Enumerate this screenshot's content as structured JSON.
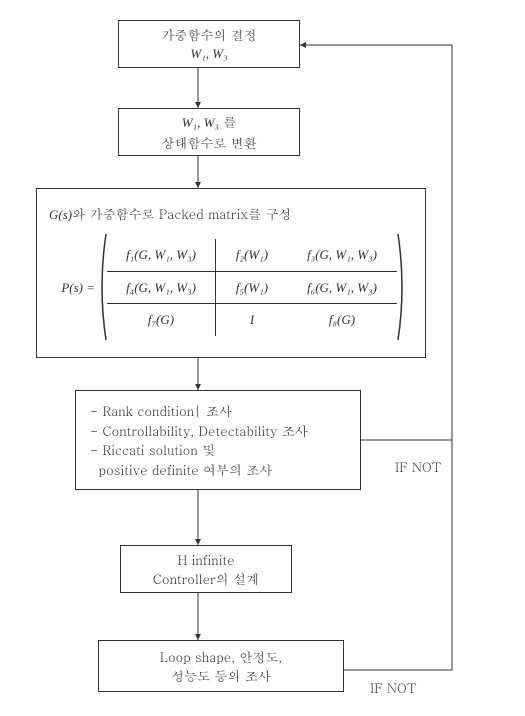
{
  "box1": {
    "line1": "가중함수의 결정",
    "line2": "W₁, W₃"
  },
  "box2": {
    "line1_a": "W₁, W₃",
    "line1_b": " 를",
    "line2": "상태함수로 변환"
  },
  "box3": {
    "title_a": "G(s)",
    "title_b": "와 가중함수로  Packed matrix를 구성",
    "prefix": "P(s) = ",
    "m11": "f₁(G, W₁, W₃)",
    "m12": "f₂(W₁)",
    "m13": "f₃(G, W₁, W₃)",
    "m21": "f₄(G, W₁, W₃)",
    "m22": "f₅(W₁)",
    "m23": "f₆(G, W₁, W₃)",
    "m31": "f₇(G)",
    "m32": "I",
    "m33": "f₈(G)"
  },
  "box4": {
    "l1": "- Rank condition| 조사",
    "l2": "- Controllability, Detectability 조사",
    "l3": "- Riccati solution 및",
    "l4": "  positive definite 여부의 조사"
  },
  "box5": {
    "l1": "H infinite",
    "l2": "Controller의 설계"
  },
  "box6": {
    "l1": "Loop shape, 안정도,",
    "l2": "성능도 등의 조사"
  },
  "labels": {
    "if_not": "IF NOT"
  },
  "chart_data": {
    "type": "flowchart",
    "nodes": [
      {
        "id": "n1",
        "text": "가중함수의 결정 W₁, W₃"
      },
      {
        "id": "n2",
        "text": "W₁, W₃ 를 상태함수로 변환"
      },
      {
        "id": "n3",
        "text": "G(s)와 가중함수로 Packed matrix를 구성; P(s) = [[f₁(G,W₁,W₃), f₂(W₁), f₃(G,W₁,W₃)], [f₄(G,W₁,W₃), f₅(W₁), f₆(G,W₁,W₃)], [f₇(G), I, f₈(G)]]"
      },
      {
        "id": "n4",
        "text": "Rank condition 조사; Controllability, Detectability 조사; Riccati solution 및 positive definite 여부의 조사"
      },
      {
        "id": "n5",
        "text": "H infinite Controller의 설계"
      },
      {
        "id": "n6",
        "text": "Loop shape, 안정도, 성능도 등의 조사"
      }
    ],
    "edges": [
      {
        "from": "n1",
        "to": "n2"
      },
      {
        "from": "n2",
        "to": "n3"
      },
      {
        "from": "n3",
        "to": "n4"
      },
      {
        "from": "n4",
        "to": "n5"
      },
      {
        "from": "n5",
        "to": "n6"
      },
      {
        "from": "n4",
        "to": "n1",
        "label": "IF NOT"
      },
      {
        "from": "n6",
        "to": "n1",
        "label": "IF NOT"
      }
    ]
  }
}
